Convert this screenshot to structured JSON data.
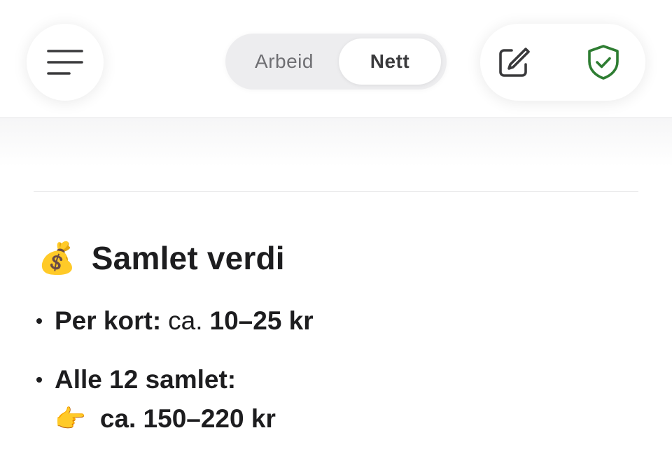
{
  "toolbar": {
    "menu_icon": "hamburger-menu-icon",
    "segments": [
      {
        "label": "Arbeid",
        "selected": false
      },
      {
        "label": "Nett",
        "selected": true
      }
    ],
    "edit_icon": "compose-icon",
    "shield_icon": "shield-check-icon",
    "shield_color": "#2e7d32"
  },
  "content": {
    "heading": {
      "emoji": "💰",
      "title": "Samlet verdi"
    },
    "items": [
      {
        "label": "Per kort:",
        "prefix": "ca.",
        "value": "10–25 kr"
      },
      {
        "label": "Alle 12 samlet:",
        "pointer_emoji": "👉",
        "value": "ca. 150–220 kr"
      }
    ]
  }
}
